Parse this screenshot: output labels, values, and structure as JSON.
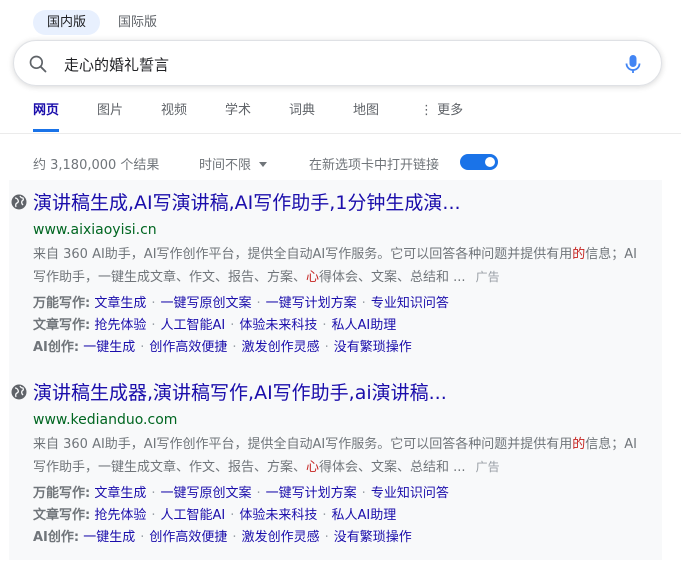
{
  "region_tabs": [
    "国内版",
    "国际版"
  ],
  "search": {
    "value": "走心的婚礼誓言"
  },
  "nav": {
    "items": [
      "网页",
      "图片",
      "视频",
      "学术",
      "词典",
      "地图",
      "⋮ 更多"
    ]
  },
  "tools": {
    "count": "约 3,180,000 个结果",
    "time_filter": "时间不限",
    "new_tab_label": "在新选项卡中打开链接",
    "new_tab_enabled": true
  },
  "results": [
    {
      "title": "演讲稿生成,AI写演讲稿,AI写作助手,1分钟生成演...",
      "url": "www.aixiaoyisi.cn",
      "desc_a": "来自 360 AI助手，AI写作创作平台，提供全自动AI写作服务。它可以回答各种问题并提供有用",
      "desc_hl1": "的",
      "desc_b": "信息；AI写作助手，一键生成文章、作文、报告、方案、",
      "desc_hl2": "心",
      "desc_c": "得体会、文案、总结和 ...",
      "ad_label": "广告",
      "sitelinks": [
        {
          "label": "万能写作:",
          "links": [
            "文章生成",
            "一键写原创文案",
            "一键写计划方案",
            "专业知识问答"
          ]
        },
        {
          "label": "文章写作:",
          "links": [
            "抢先体验",
            "人工智能AI",
            "体验未来科技",
            "私人AI助理"
          ]
        },
        {
          "label": "AI创作:",
          "links": [
            "一键生成",
            "创作高效便捷",
            "激发创作灵感",
            "没有繁琐操作"
          ]
        }
      ]
    },
    {
      "title": "演讲稿生成器,演讲稿写作,AI写作助手,ai演讲稿...",
      "url": "www.kedianduo.com",
      "desc_a": "来自 360 AI助手，AI写作创作平台，提供全自动AI写作服务。它可以回答各种问题并提供有用",
      "desc_hl1": "的",
      "desc_b": "信息；AI写作助手，一键生成文章、作文、报告、方案、",
      "desc_hl2": "心",
      "desc_c": "得体会、文案、总结和 ...",
      "ad_label": "广告",
      "sitelinks": [
        {
          "label": "万能写作:",
          "links": [
            "文章生成",
            "一键写原创文案",
            "一键写计划方案",
            "专业知识问答"
          ]
        },
        {
          "label": "文章写作:",
          "links": [
            "抢先体验",
            "人工智能AI",
            "体验未来科技",
            "私人AI助理"
          ]
        },
        {
          "label": "AI创作:",
          "links": [
            "一键生成",
            "创作高效便捷",
            "激发创作灵感",
            "没有繁琐操作"
          ]
        }
      ]
    }
  ]
}
